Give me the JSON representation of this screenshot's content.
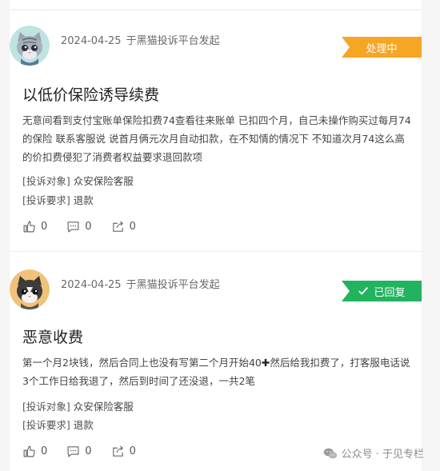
{
  "complaints": [
    {
      "date": "2024-04-25",
      "source": "于黑猫投诉平台发起",
      "status": "处理中",
      "title": "以低价保险诱导续费",
      "body": "无意间看到支付宝账单保险扣费74查看往来账单 已扣四个月，自己未操作购买过每月74的保险 联系客服说 说首月俩元次月自动扣款，在不知情的情况下 不知道次月74这么高的价扣费侵犯了消费者权益要求退回款项",
      "target_label": "[投诉对象]",
      "target": "众安保险客服",
      "demand_label": "[投诉要求]",
      "demand": "退款",
      "likes": "0",
      "comments": "0",
      "shares": "0"
    },
    {
      "date": "2024-04-25",
      "source": "于黑猫投诉平台发起",
      "status": "已回复",
      "title": "恶意收费",
      "body_part1": "第一个月2块钱，然后合同上也没有写第二个月开始40",
      "body_plus": "✚",
      "body_part2": "然后给我扣费了，打客服电话说3个工作日给我退了，然后到时间了还没退，一共2笔",
      "target_label": "[投诉对象]",
      "target": "众安保险客服",
      "demand_label": "[投诉要求]",
      "demand": "退款",
      "likes": "0",
      "comments": "0",
      "shares": "0"
    }
  ],
  "watermark": "公众号 · 于见专栏",
  "colors": {
    "processing": "#f5a623",
    "replied": "#22b35e"
  },
  "icons": [
    "cat-avatar-gray",
    "cat-avatar-black",
    "thumbs-up-icon",
    "comment-icon",
    "share-icon",
    "check-icon",
    "wechat-icon"
  ]
}
